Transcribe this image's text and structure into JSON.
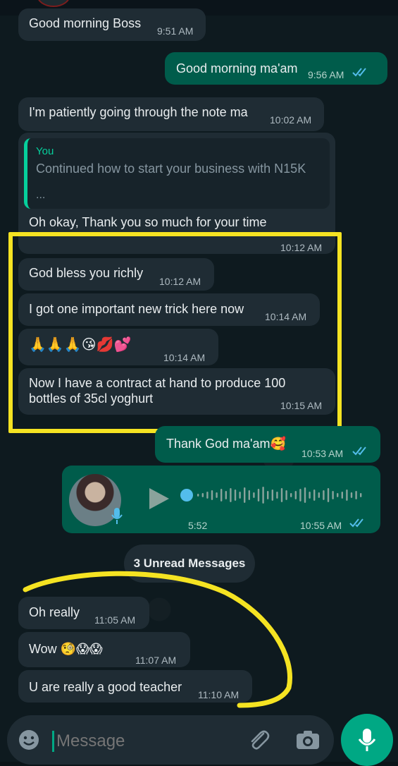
{
  "messages": [
    {
      "text": "Good morning Boss",
      "time": "9:51 AM"
    },
    {
      "text": "Good morning ma'am",
      "time": "9:56 AM"
    },
    {
      "text": "I'm patiently going through the note ma",
      "time": "10:02 AM"
    },
    {
      "quote_author": "You",
      "quote_text": "Continued how to start your business with N15K",
      "quote_ellipsis": "...",
      "text": "Oh okay, Thank you so much for your time",
      "time": "10:12 AM"
    },
    {
      "text": "God bless you richly",
      "time": "10:12 AM"
    },
    {
      "text": "I got one important new trick here now",
      "time": "10:14 AM"
    },
    {
      "text": "🙏🙏🙏😘💋💕",
      "time": "10:14 AM"
    },
    {
      "text_line1": "Now I have a contract at hand  to produce 100",
      "text_line2": "bottles of 35cl yoghurt",
      "time": "10:15 AM"
    },
    {
      "text": "Thank God ma'am🥰",
      "time": "10:53 AM"
    },
    {
      "duration": "5:52",
      "time": "10:55 AM"
    },
    {
      "text": "Oh really",
      "time": "11:05 AM"
    },
    {
      "text": "Wow 🧐😱😱",
      "time": "11:07 AM"
    },
    {
      "text": "U are really a good teacher",
      "time": "11:10 AM"
    }
  ],
  "unread_label": "3 Unread Messages",
  "input": {
    "placeholder": "Message"
  },
  "colors": {
    "incoming": "#1f2c34",
    "outgoing": "#005c4b",
    "accent": "#00a884",
    "highlight": "#f5e322",
    "read_ticks": "#53bdeb"
  },
  "icons": [
    "emoji-icon",
    "attach-icon",
    "camera-icon",
    "mic-icon",
    "play-icon",
    "double-check-icon"
  ]
}
